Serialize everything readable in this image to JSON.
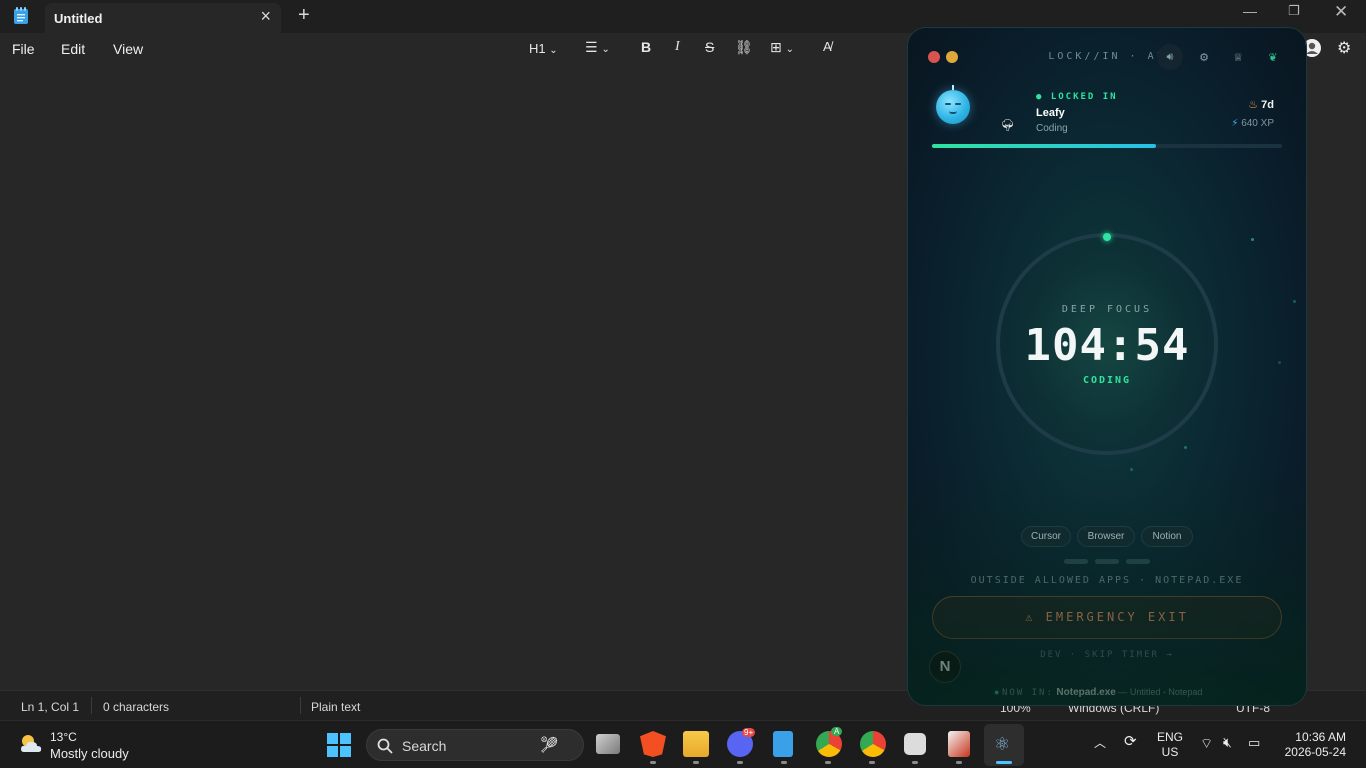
{
  "notepad": {
    "tab_title": "Untitled",
    "menus": [
      "File",
      "Edit",
      "View"
    ],
    "toolbar": {
      "heading": "H1"
    },
    "status": {
      "position": "Ln 1, Col 1",
      "characters": "0 characters",
      "format": "Plain text",
      "zoom": "100%",
      "line_ending": "Windows (CRLF)",
      "encoding": "UTF-8"
    }
  },
  "widget": {
    "brand": "LOCK//IN · AI",
    "status": "● LOCKED IN",
    "pet_name": "Leafy",
    "activity": "Coding",
    "streak": "7d",
    "xp": "640 XP",
    "session_progress": 0.64,
    "mode": "DEEP FOCUS",
    "timer": "104:54",
    "category": "CODING",
    "allowed_apps": [
      "Cursor",
      "Browser",
      "Notion"
    ],
    "outside_message": "OUTSIDE ALLOWED APPS · NOTEPAD.EXE",
    "emergency_exit": "EMERGENCY EXIT",
    "skip_timer": "DEV · SKIP TIMER →",
    "now_in_label": "NOW IN:",
    "now_in_app": "Notepad.exe",
    "now_in_window": "— Untitled - Notepad",
    "badge": "N",
    "accent": "#2fe3a0",
    "danger": "#ee8b5f"
  },
  "taskbar": {
    "weather_temp": "13°C",
    "weather_desc": "Mostly cloudy",
    "search_label": "Search",
    "discord_badge": "9+",
    "chrome_badge": "A",
    "lang_1": "ENG",
    "lang_2": "US",
    "time": "10:36 AM",
    "date": "2026-05-24"
  }
}
